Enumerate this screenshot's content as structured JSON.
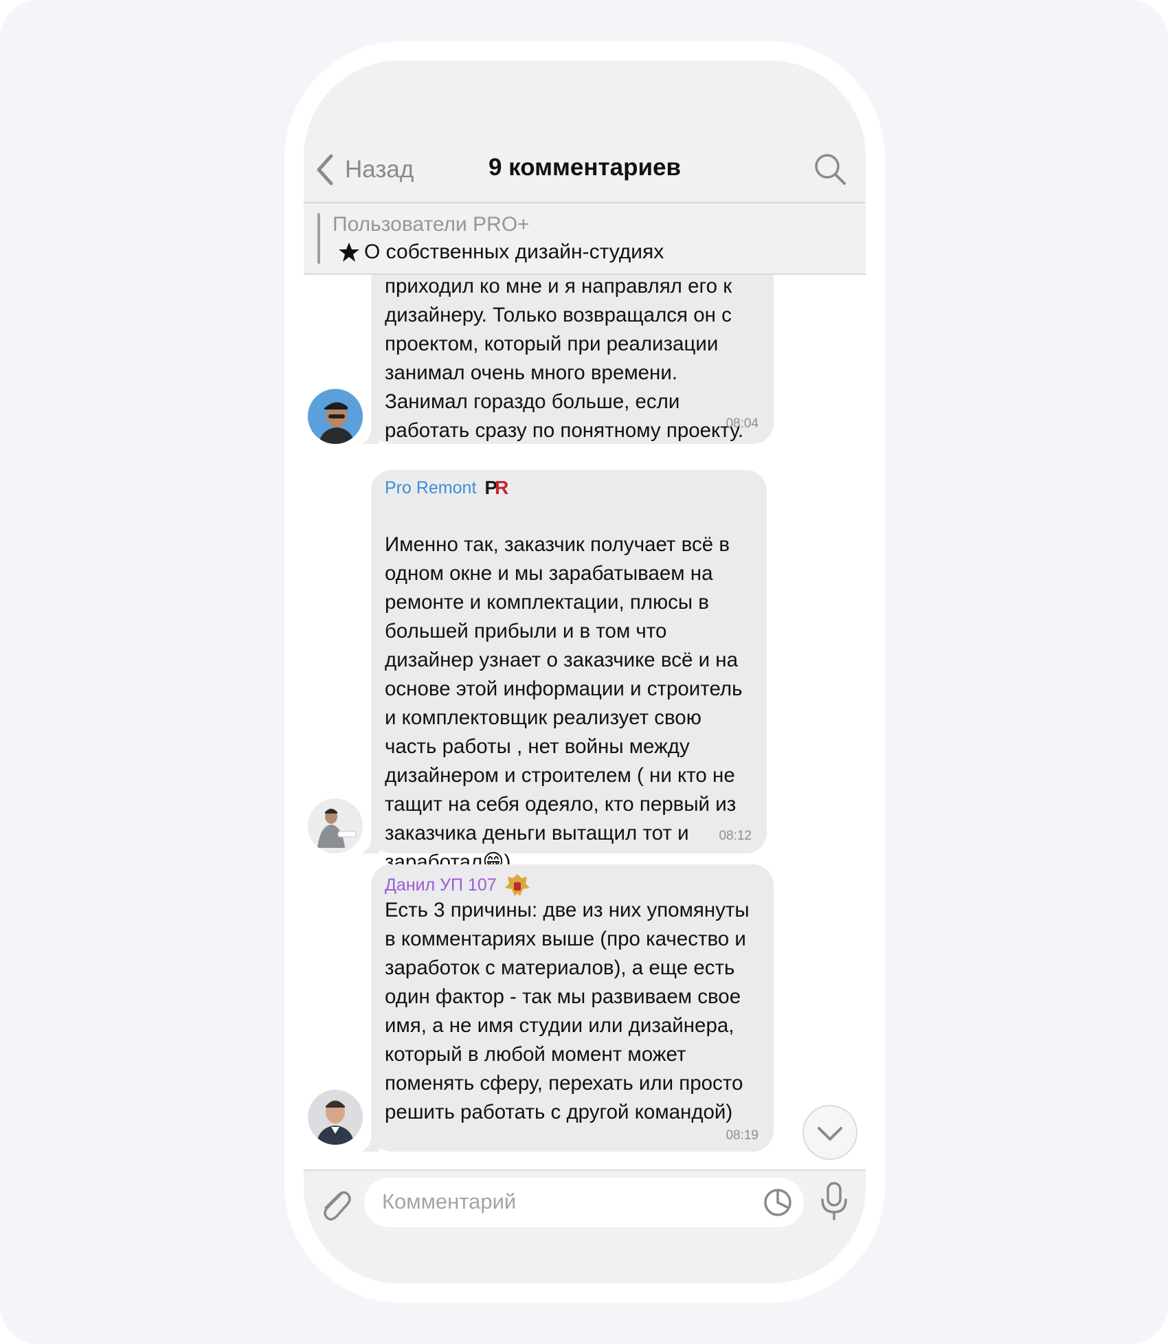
{
  "header": {
    "back_label": "Назад",
    "title": "9 комментариев"
  },
  "pinned": {
    "title": "Пользователи PRO+",
    "subtitle": "О собственных дизайн-студиях"
  },
  "messages": [
    {
      "sender": "",
      "text": "приходил ко мне и я направлял его к\nдизайнеру. Только возвращался он с\nпроектом, который при реализации\nзанимал очень много времени.\nЗанимал гораздо больше, если\nработать сразу по понятному проекту.",
      "time": "08:04"
    },
    {
      "sender": "Pro Remont",
      "sender_color": "#3a8fd6",
      "badge": "PR",
      "text": "Именно так, заказчик получает всё в\nодном окне  и мы зарабатываем на\nремонте и комплектации, плюсы в\nбольшей прибыли  и в том что\nдизайнер узнает о заказчике всё и на\nоснове этой информации и строитель\nи комплектовщик реализует свою\nчасть работы , нет войны между\nдизайнером и строителем ( ни кто не\nтащит на себя одеяло, кто первый из\nзаказчика деньги вытащил тот и\nзаработал",
      "text_end": ")",
      "emoji": "😁",
      "time": "08:12"
    },
    {
      "sender": "Данил УП 107",
      "sender_color": "#9b5bd6",
      "text": "Есть 3 причины: две из них упомянуты\nв комментариях выше (про качество и\nзаработок с материалов), а еще есть\nодин фактор - так мы развиваем свое\nимя, а не имя студии или дизайнера,\nкоторый в любой момент может\nпоменять сферу, перехать или просто\nрешить работать с другой командой)",
      "time": "08:19"
    }
  ],
  "input": {
    "placeholder": "Комментарий"
  },
  "icons": {
    "back": "chevron-left-icon",
    "search": "search-icon",
    "star": "star-icon",
    "attach": "paperclip-icon",
    "sticker": "sticker-icon",
    "mic": "microphone-icon",
    "scroll_down": "chevron-down-icon"
  },
  "colors": {
    "bubble": "#ebebed",
    "accent_blue": "#3a8fd6",
    "accent_purple": "#9b5bd6"
  }
}
